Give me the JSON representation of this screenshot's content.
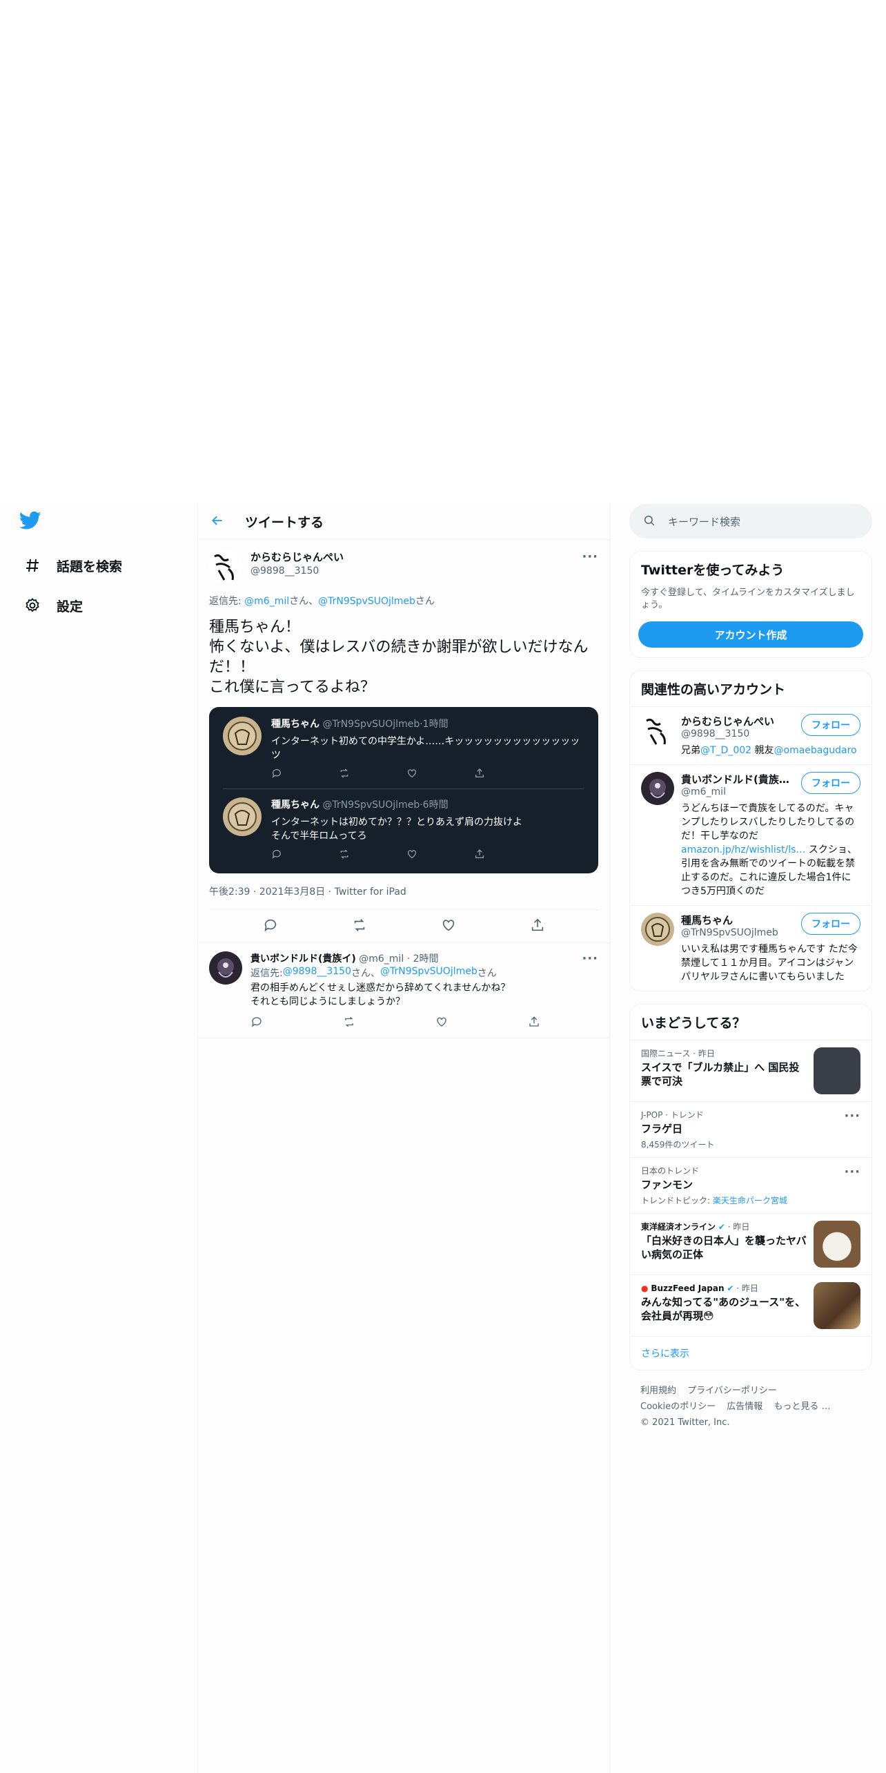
{
  "nav": {
    "explore_label": "話題を検索",
    "settings_label": "設定"
  },
  "header": {
    "title": "ツイートする"
  },
  "main_tweet": {
    "name": "からむらじゃんぺい",
    "handle": "@9898__3150",
    "reply_prefix": "返信先: ",
    "reply_user1": "@m6_mil",
    "reply_sep1": "さん、",
    "reply_user2": "@TrN9SpvSUOjlmeb",
    "reply_sep2": "さん",
    "text": "種馬ちゃん！\n怖くないよ、僕はレスバの続きか謝罪が欲しいだけなんだ！！\nこれ僕に言ってるよね？",
    "quoted": [
      {
        "name": "種馬ちゃん",
        "handle": "@TrN9SpvSUOjlmeb",
        "time": "·1時間",
        "text": "インターネット初めての中学生かよ……キッッッッッッッッッッッッッツ"
      },
      {
        "name": "種馬ちゃん",
        "handle": "@TrN9SpvSUOjlmeb",
        "time": "·6時間",
        "text": "インターネットは初めてか？？？とりあえず肩の力抜けよ\nそんで半年ロムってろ"
      }
    ],
    "meta": "午後2:39 · 2021年3月8日 · Twitter for iPad"
  },
  "reply_tweet": {
    "name": "貴いボンドルド(貴族イ)",
    "handle": "@m6_mil",
    "time": "· 2時間",
    "reply_prefix": "返信先: ",
    "reply_user1": "@9898__3150",
    "reply_sep1": "さん、",
    "reply_user2": "@TrN9SpvSUOjlmeb",
    "reply_sep2": "さん",
    "text": "君の相手めんどくせぇし迷惑だから辞めてくれませんかね？\nそれとも同じようにしましょうか？"
  },
  "search": {
    "placeholder": "キーワード検索"
  },
  "signup": {
    "title": "Twitterを使ってみよう",
    "sub": "今すぐ登録して、タイムラインをカスタマイズしましょう。",
    "button": "アカウント作成"
  },
  "related": {
    "title": "関連性の高いアカウント",
    "follow_label": "フォロー",
    "accounts": [
      {
        "name": "からむらじゃんぺい",
        "handle": "@9898__3150",
        "bio_a": "兄弟",
        "bio_link1": "@T_D_002",
        "bio_b": " 親友",
        "bio_link2": "@omaebagudaro"
      },
      {
        "name": "貴いボンドルド(貴族…",
        "handle": "@m6_mil",
        "bio_a": "うどんちほーで貴族をしてるのだ。キャンプしたりレスバしたりしたりしてるのだ！干し芋なのだ",
        "bio_link1": "amazon.jp/hz/wishlist/ls…",
        "bio_b": " スクショ、引用を含み無断でのツイートの転載を禁止するのだ。これに違反した場合1件につき5万円頂くのだ"
      },
      {
        "name": "種馬ちゃん",
        "handle": "@TrN9SpvSUOjlmeb",
        "bio_a": "いいえ私は男です種馬ちゃんです ただ今禁煙して１１か月目。アイコンはジャンパリヤルヲさんに書いてもらいました"
      }
    ]
  },
  "trends": {
    "title": "いまどうしてる？",
    "items": [
      {
        "meta": "国際ニュース · 昨日",
        "name": "スイスで「ブルカ禁止」へ 国民投票で可決",
        "thumb_color": "#3a3f47"
      },
      {
        "meta": "J-POP · トレンド",
        "name": "フラゲ日",
        "count": "8,459件のツイート"
      },
      {
        "meta": "日本のトレンド",
        "name": "ファンモン",
        "count_prefix": "トレンドトピック: ",
        "count_link": "楽天生命パーク宮城"
      },
      {
        "meta_source": "東洋経済オンライン",
        "meta_time": " · 昨日",
        "name": "「白米好きの日本人」を襲ったヤバい病気の正体",
        "thumb_color": "#7a5a3a"
      },
      {
        "meta_source": "BuzzFeed Japan",
        "meta_time": " · 昨日",
        "name": "みんな知ってる\"あのジュース\"を、会社員が再現😳",
        "thumb_color": "#6b4a2e"
      }
    ],
    "show_more": "さらに表示"
  },
  "footer": {
    "terms": "利用規約",
    "privacy": "プライバシーポリシー",
    "cookie": "Cookieのポリシー",
    "ads": "広告情報",
    "more": "もっと見る …",
    "copyright": "© 2021 Twitter, Inc."
  },
  "colors": {
    "accent": "#1d9bf0",
    "dark_card": "#15202b"
  }
}
